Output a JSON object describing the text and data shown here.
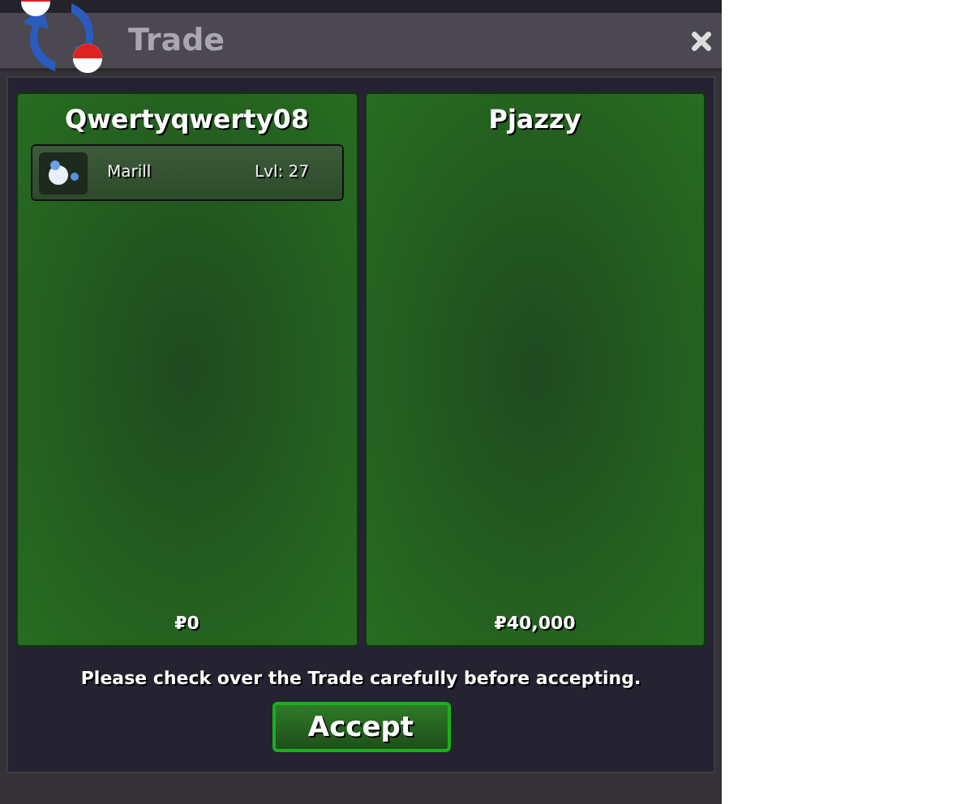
{
  "window": {
    "title": "Trade"
  },
  "traders": [
    {
      "name": "Qwertyqwerty08",
      "items": [
        {
          "name": "Marill",
          "level": "Lvl: 27"
        }
      ],
      "money": "₽0"
    },
    {
      "name": "Pjazzy",
      "money": "₽40,000"
    }
  ],
  "notice": "Please check over the Trade carefully before accepting.",
  "buttons": [
    "Accept"
  ]
}
